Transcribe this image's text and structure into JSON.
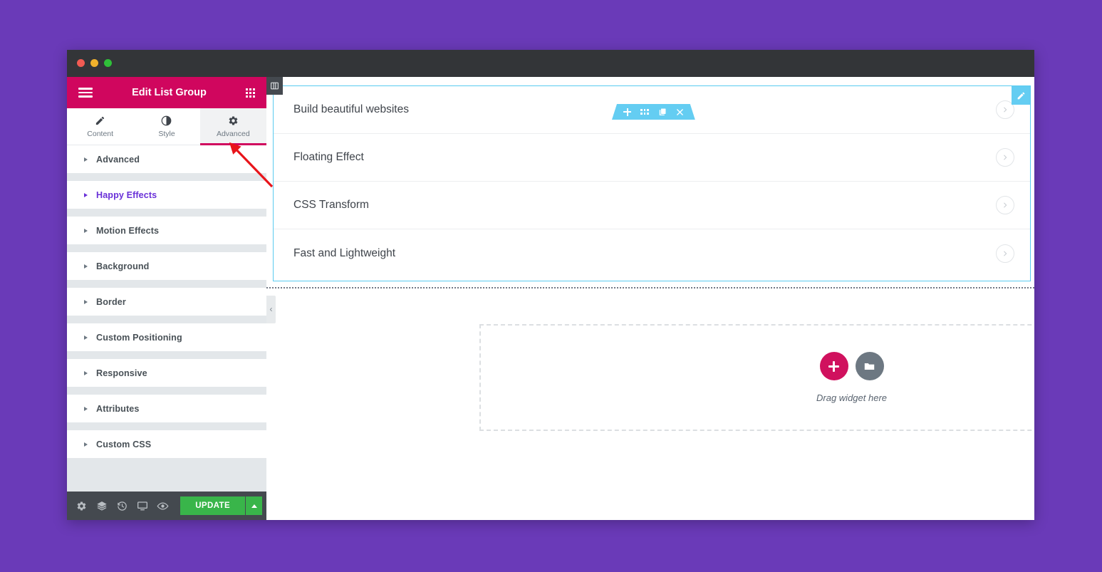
{
  "window": {
    "traffic_lights": [
      "close",
      "minimize",
      "maximize"
    ],
    "colors": {
      "desktop_background": "#6a3ab8",
      "titlebar": "#333538",
      "panel_header": "#d0065e",
      "accent_pink": "#d0065e",
      "update_green": "#39b54a",
      "selection_cyan": "#64cdf2",
      "highlight_purple": "#6a31d8",
      "annotation_red": "#e8141a"
    }
  },
  "panel": {
    "header": {
      "title": "Edit List Group",
      "menu_icon": "hamburger-menu-icon",
      "apps_icon": "grid-apps-icon"
    },
    "tabs": [
      {
        "label": "Content",
        "icon": "pencil-icon",
        "active": false
      },
      {
        "label": "Style",
        "icon": "contrast-icon",
        "active": false
      },
      {
        "label": "Advanced",
        "icon": "gear-icon",
        "active": true
      }
    ],
    "sections": [
      {
        "label": "Advanced",
        "highlighted": false
      },
      {
        "label": "Happy Effects",
        "highlighted": true
      },
      {
        "label": "Motion Effects",
        "highlighted": false
      },
      {
        "label": "Background",
        "highlighted": false
      },
      {
        "label": "Border",
        "highlighted": false
      },
      {
        "label": "Custom Positioning",
        "highlighted": false
      },
      {
        "label": "Responsive",
        "highlighted": false
      },
      {
        "label": "Attributes",
        "highlighted": false
      },
      {
        "label": "Custom CSS",
        "highlighted": false
      }
    ],
    "footer": {
      "icons": [
        {
          "name": "settings-gear-icon",
          "title": "Settings"
        },
        {
          "name": "navigator-layers-icon",
          "title": "Navigator"
        },
        {
          "name": "history-clock-icon",
          "title": "History"
        },
        {
          "name": "responsive-monitor-icon",
          "title": "Responsive Mode"
        },
        {
          "name": "preview-eye-icon",
          "title": "Preview Changes"
        }
      ],
      "update_label": "UPDATE",
      "update_caret": "caret-up-icon"
    }
  },
  "canvas": {
    "panel_toggle_icon": "panel-layout-icon",
    "collapse_handle_icon": "chevron-left-icon",
    "section_toolbar": [
      {
        "name": "add-section-icon",
        "glyph": "plus"
      },
      {
        "name": "edit-section-icon",
        "glyph": "six-dots"
      },
      {
        "name": "duplicate-section-icon",
        "glyph": "copy"
      },
      {
        "name": "delete-section-icon",
        "glyph": "close-x"
      }
    ],
    "edit_badge_icon": "edit-pencil-icon",
    "list_items": [
      {
        "text": "Build beautiful websites",
        "arrow": "chevron-right-icon"
      },
      {
        "text": "Floating Effect",
        "arrow": "chevron-right-icon"
      },
      {
        "text": "CSS Transform",
        "arrow": "chevron-right-icon"
      },
      {
        "text": "Fast and Lightweight",
        "arrow": "chevron-right-icon"
      }
    ],
    "dropzone": {
      "add_icon": "plus-icon",
      "template_icon": "folder-icon",
      "label": "Drag widget here"
    }
  },
  "annotation": {
    "type": "arrow",
    "points_to": "advanced-tab-underline",
    "color": "#e8141a"
  }
}
